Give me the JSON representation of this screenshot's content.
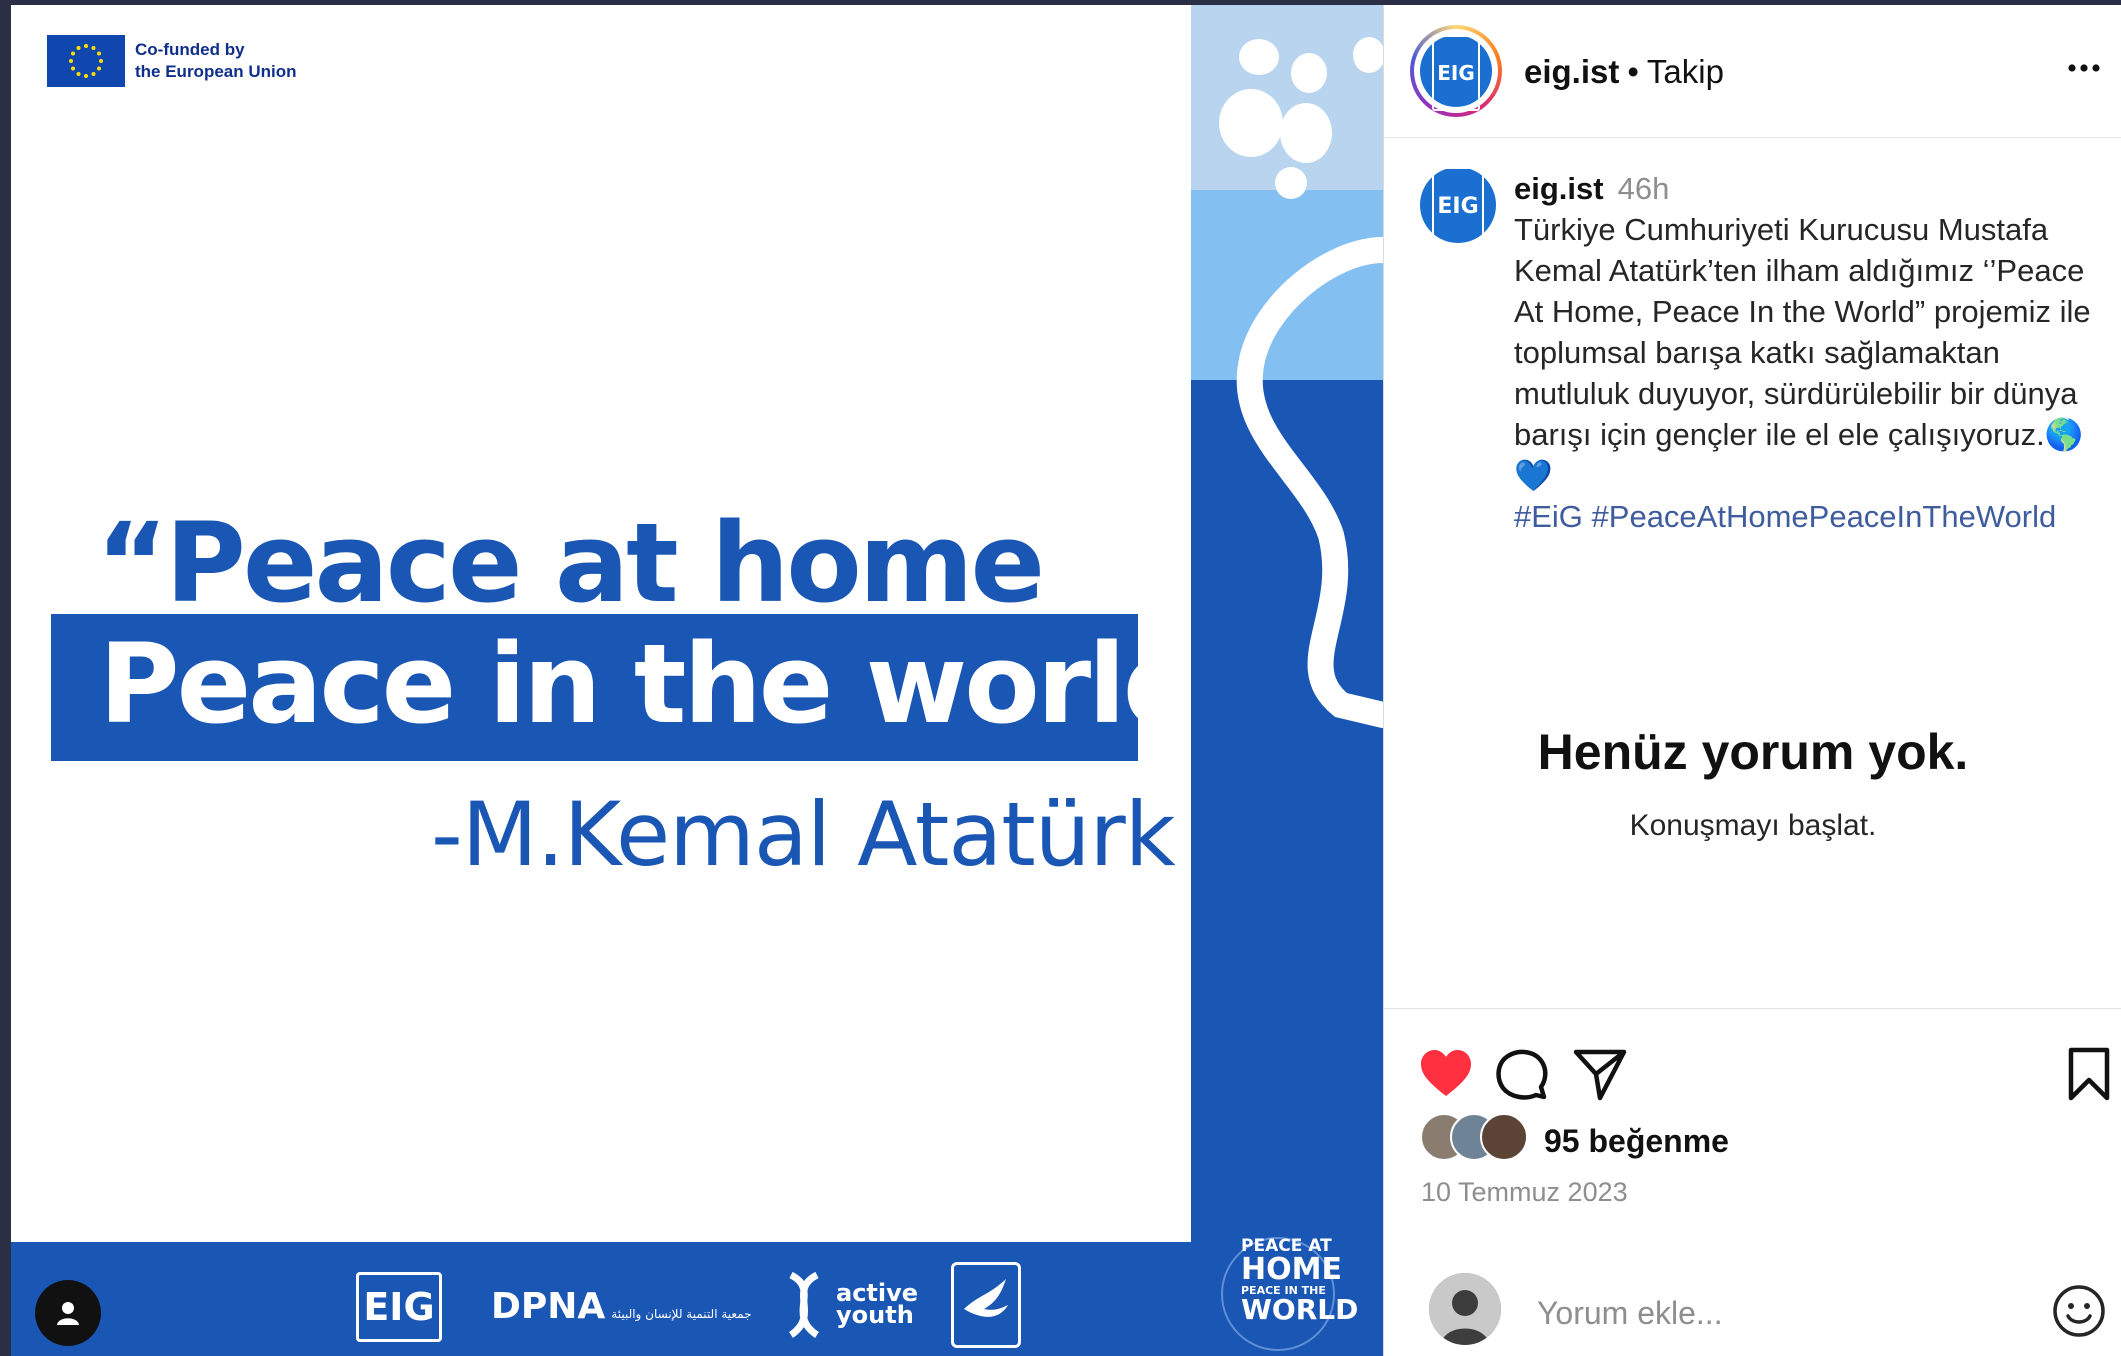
{
  "post_image": {
    "eu_badge": {
      "line1": "Co-funded by",
      "line2": "the European Union"
    },
    "quote_line1": "“Peace at home",
    "quote_line2": "Peace in the world”",
    "author": "-M.Kemal Atatürk",
    "partners": {
      "eig": "EIG",
      "dpna": "DPNA",
      "dpna_sub": "جمعية التنمية للإنسان والبيئة",
      "active_youth_1": "active",
      "active_youth_2": "youth"
    },
    "badge": {
      "line1": "PEACE AT",
      "line2": "HOME",
      "line3": "PEACE IN THE",
      "line4": "WORLD"
    },
    "colors": {
      "brand_blue": "#1a56b4",
      "light_blue": "#84bff2",
      "pale_blue": "#b8d4ee"
    }
  },
  "header": {
    "avatar_text": "EIG",
    "username": "eig.ist",
    "separator": "•",
    "follow_label": "Takip",
    "more_icon": "more-horizontal-icon"
  },
  "caption": {
    "avatar_text": "EIG",
    "author": "eig.ist",
    "time": "46h",
    "text": "Türkiye Cumhuriyeti Kurucusu Mustafa Kemal Atatürk’ten ilham aldığımız ‘’Peace At Home, Peace In the World” projemiz ile toplumsal barışa katkı sağlamaktan mutluluk duyuyor, sürdürülebilir bir dünya barışı için gençler ile el ele çalışıyoruz.🌎 💙",
    "hashtags": "#EiG #PeaceAtHomePeaceInTheWorld"
  },
  "comments": {
    "empty_title": "Henüz yorum yok.",
    "empty_subtitle": "Konuşmayı başlat."
  },
  "actions": {
    "like_icon": "heart-filled-icon",
    "comment_icon": "comment-icon",
    "share_icon": "send-icon",
    "save_icon": "bookmark-icon",
    "like_color": "#ff3040"
  },
  "likes": {
    "text": "95 beğenme"
  },
  "date": "10 Temmuz 2023",
  "add_comment": {
    "placeholder": "Yorum ekle..."
  }
}
